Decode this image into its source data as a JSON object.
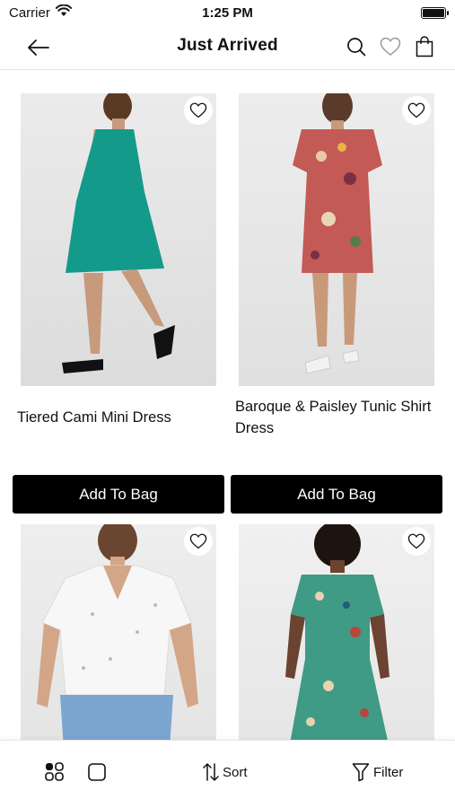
{
  "status": {
    "carrier": "Carrier",
    "time": "1:25 PM"
  },
  "header": {
    "title": "Just Arrived"
  },
  "products": [
    {
      "name": "Tiered Cami Mini Dress",
      "button": "Add To Bag"
    },
    {
      "name": "Baroque & Paisley Tunic Shirt Dress",
      "button": "Add To Bag"
    },
    {
      "name": "",
      "button": ""
    },
    {
      "name": "",
      "button": ""
    }
  ],
  "bottom_bar": {
    "sort_label": "Sort",
    "filter_label": "Filter"
  },
  "colors": {
    "accent": "#000000",
    "background": "#ffffff",
    "text": "#111111",
    "divider": "#e6e6e6"
  },
  "icons": [
    "back-arrow-icon",
    "search-icon",
    "heart-icon",
    "bag-icon",
    "grid-view-icon",
    "single-view-icon",
    "sort-icon",
    "filter-icon",
    "wifi-icon",
    "battery-icon"
  ]
}
